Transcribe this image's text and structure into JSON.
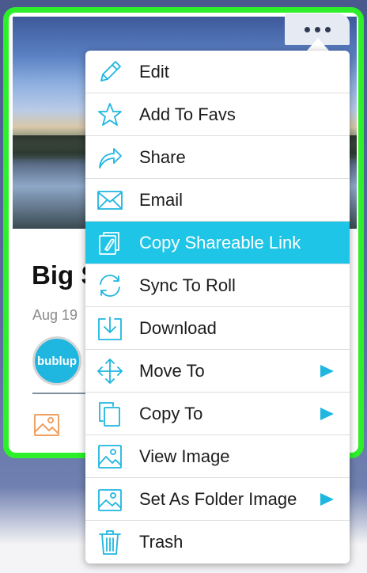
{
  "card": {
    "title": "Big S",
    "date": "Aug 19",
    "avatar_text": "bublup"
  },
  "menu": {
    "items": [
      {
        "label": "Edit",
        "icon": "pencil-icon",
        "submenu": false
      },
      {
        "label": "Add To Favs",
        "icon": "star-icon",
        "submenu": false
      },
      {
        "label": "Share",
        "icon": "share-arrow-icon",
        "submenu": false
      },
      {
        "label": "Email",
        "icon": "envelope-icon",
        "submenu": false
      },
      {
        "label": "Copy Shareable Link",
        "icon": "copy-link-icon",
        "submenu": false,
        "selected": true
      },
      {
        "label": "Sync To Roll",
        "icon": "sync-icon",
        "submenu": false
      },
      {
        "label": "Download",
        "icon": "download-icon",
        "submenu": false
      },
      {
        "label": "Move To",
        "icon": "move-arrows-icon",
        "submenu": true
      },
      {
        "label": "Copy To",
        "icon": "copy-icon",
        "submenu": true
      },
      {
        "label": "View Image",
        "icon": "image-icon",
        "submenu": false
      },
      {
        "label": "Set As Folder Image",
        "icon": "folder-image-icon",
        "submenu": true
      },
      {
        "label": "Trash",
        "icon": "trash-icon",
        "submenu": false
      }
    ]
  },
  "colors": {
    "accent": "#1fb6e0",
    "selected_bg": "#1fc5e6",
    "card_border": "#2ef02a",
    "image_thumb_icon": "#f0a060"
  }
}
